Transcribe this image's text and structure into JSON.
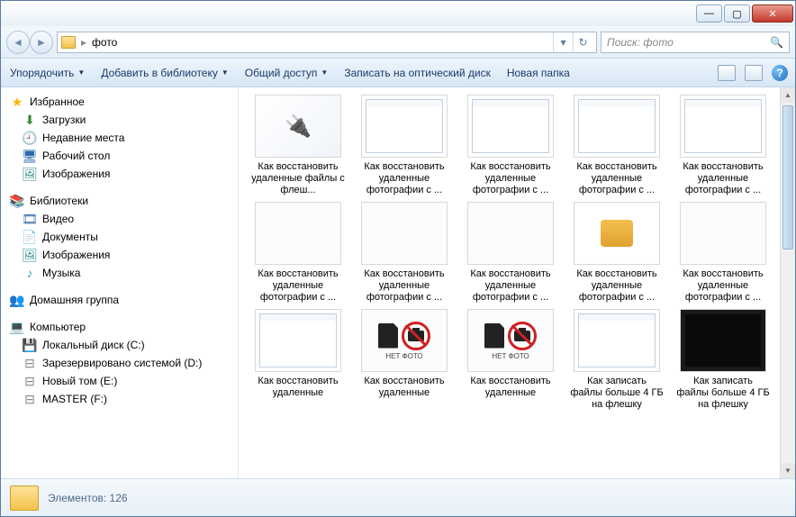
{
  "address": {
    "crumb": "фото"
  },
  "search": {
    "placeholder": "Поиск: фото"
  },
  "toolbar": {
    "organize": "Упорядочить",
    "addlib": "Добавить в библиотеку",
    "share": "Общий доступ",
    "burn": "Записать на оптический диск",
    "newfolder": "Новая папка"
  },
  "sidebar": {
    "fav": {
      "header": "Избранное",
      "items": [
        "Загрузки",
        "Недавние места",
        "Рабочий стол",
        "Изображения"
      ]
    },
    "lib": {
      "header": "Библиотеки",
      "items": [
        "Видео",
        "Документы",
        "Изображения",
        "Музыка"
      ]
    },
    "hg": {
      "header": "Домашняя группа"
    },
    "comp": {
      "header": "Компьютер",
      "items": [
        "Локальный диск (C:)",
        "Зарезервировано системой (D:)",
        "Новый том (E:)",
        "MASTER (F:)"
      ]
    }
  },
  "files": [
    {
      "label": "Как восстановить удаленные файлы с флеш...",
      "kind": "usb"
    },
    {
      "label": "Как восстановить удаленные фотографии с ...",
      "kind": "screenshot"
    },
    {
      "label": "Как восстановить удаленные фотографии с ...",
      "kind": "screenshot"
    },
    {
      "label": "Как восстановить удаленные фотографии с ...",
      "kind": "screenshot"
    },
    {
      "label": "Как восстановить удаленные фотографии с ...",
      "kind": "screenshot"
    },
    {
      "label": "Как восстановить удаленные фотографии с ...",
      "kind": "redtop"
    },
    {
      "label": "Как восстановить удаленные фотографии с ...",
      "kind": "redtop"
    },
    {
      "label": "Как восстановить удаленные фотографии с ...",
      "kind": "redtop"
    },
    {
      "label": "Как восстановить удаленные фотографии с ...",
      "kind": "boxicon"
    },
    {
      "label": "Как восстановить удаленные фотографии с ...",
      "kind": "redtop"
    },
    {
      "label": "Как восстановить удаленные",
      "kind": "screenshot"
    },
    {
      "label": "Как восстановить удаленные",
      "kind": "nophoto",
      "sub": "НЕТ ФОТО"
    },
    {
      "label": "Как восстановить удаленные",
      "kind": "nophoto",
      "sub": "НЕТ ФОТО"
    },
    {
      "label": "Как записать файлы больше 4 ГБ на флешку",
      "kind": "screenshot"
    },
    {
      "label": "Как записать файлы больше 4 ГБ на флешку",
      "kind": "dark"
    }
  ],
  "status": {
    "text": "Элементов: 126"
  }
}
